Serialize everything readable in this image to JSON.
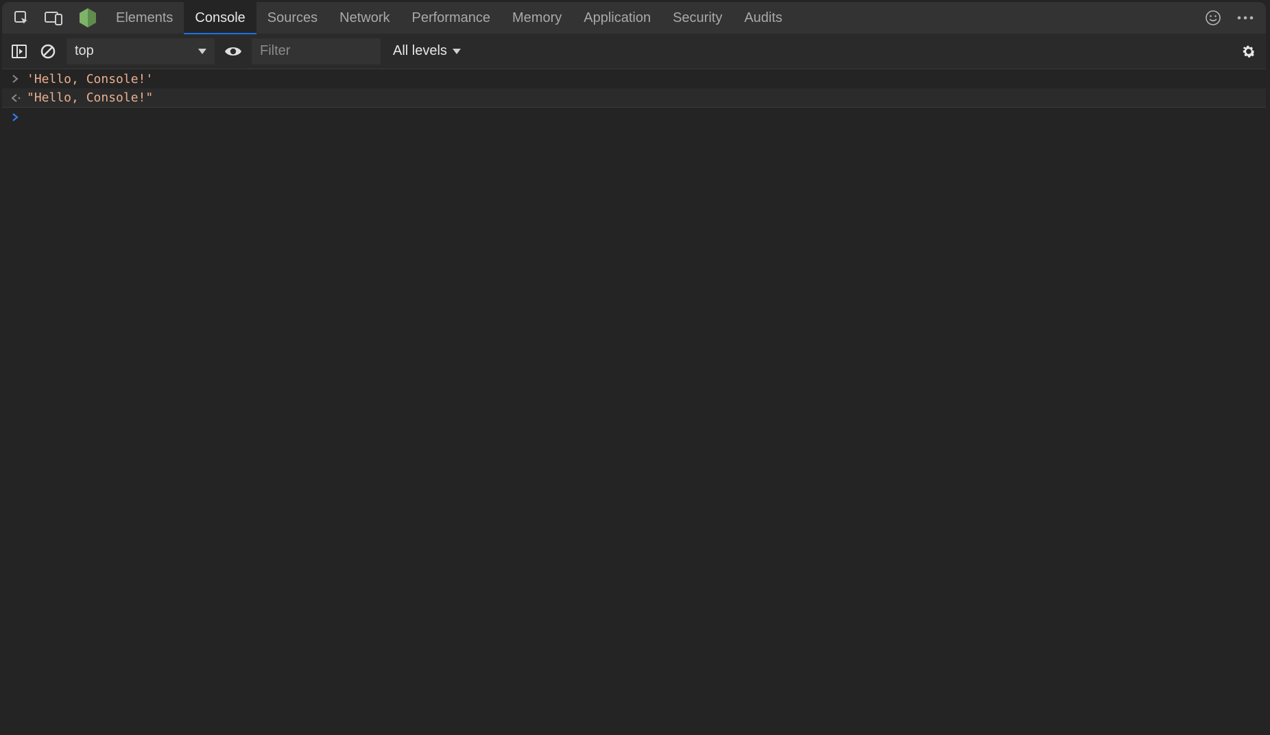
{
  "tabs": {
    "items": [
      "Elements",
      "Console",
      "Sources",
      "Network",
      "Performance",
      "Memory",
      "Application",
      "Security",
      "Audits"
    ],
    "active_index": 1
  },
  "toolbar": {
    "context": "top",
    "filter_placeholder": "Filter",
    "log_level": "All levels"
  },
  "console": {
    "rows": [
      {
        "kind": "input",
        "text": "'Hello, Console!'"
      },
      {
        "kind": "output",
        "text": "\"Hello, Console!\""
      },
      {
        "kind": "prompt",
        "text": ""
      }
    ]
  },
  "icons": {
    "node_color": "#7fb36a"
  }
}
